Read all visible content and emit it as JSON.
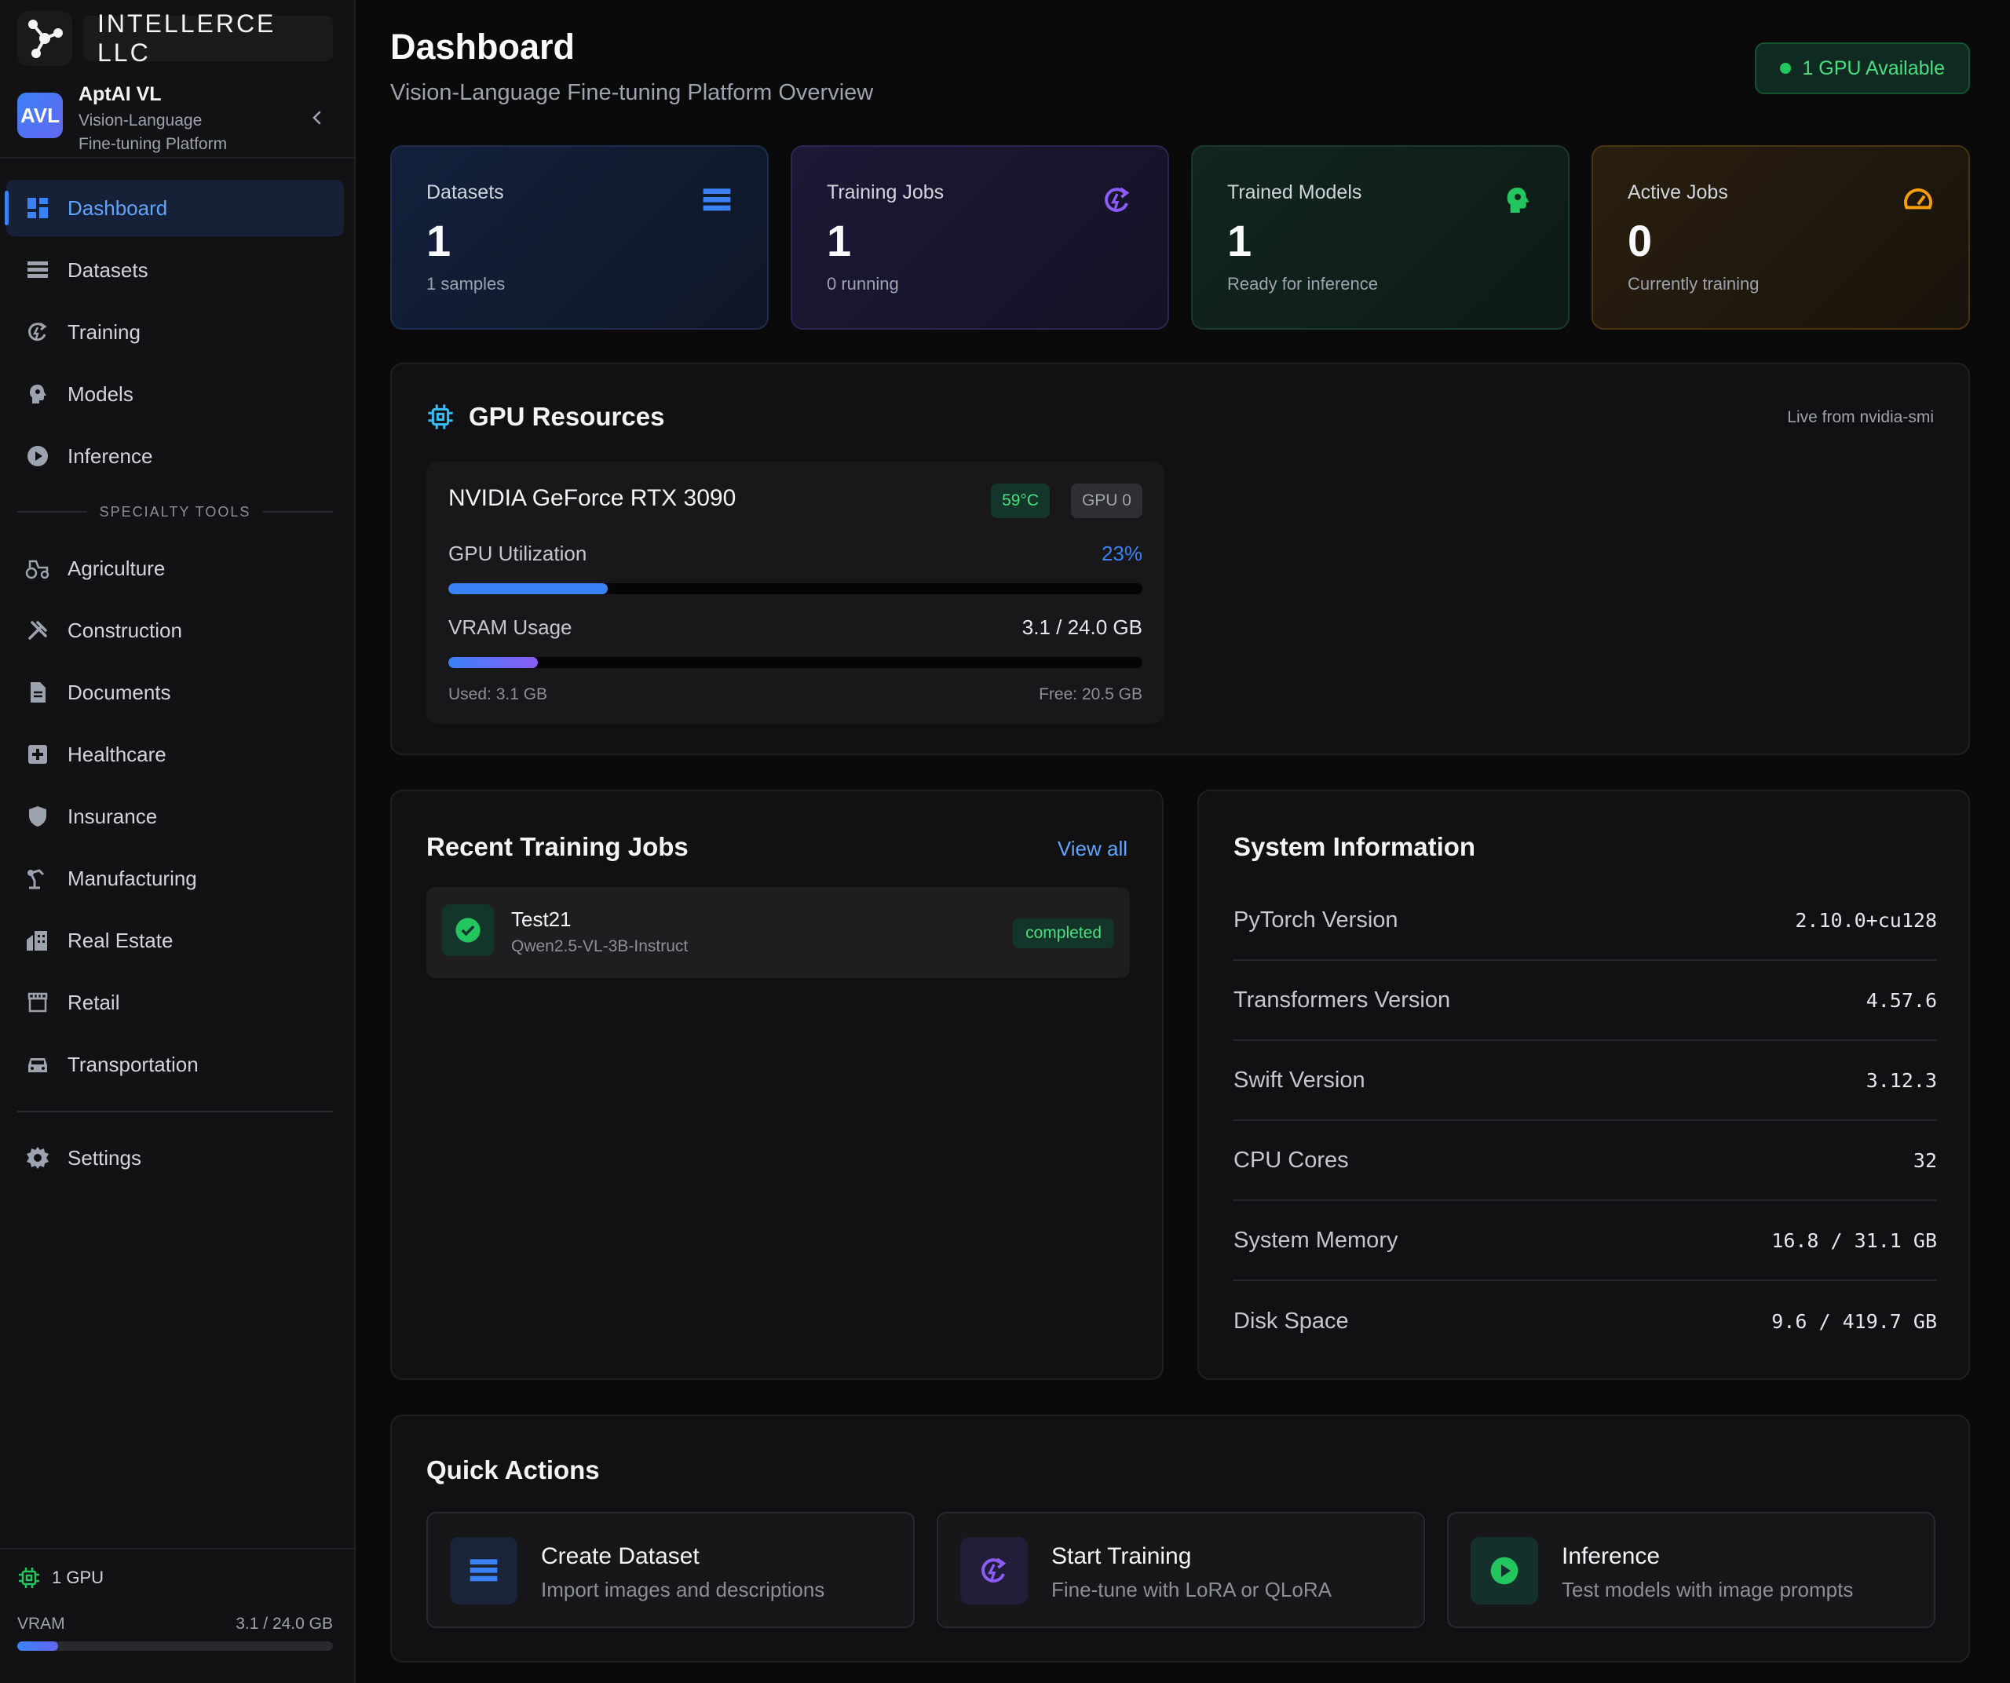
{
  "brand": {
    "wordmark": "INTELLERCE LLC"
  },
  "app": {
    "avatar": "AVL",
    "name": "AptAI VL",
    "subtitle_line1": "Vision-Language",
    "subtitle_line2": "Fine-tuning Platform"
  },
  "nav": {
    "main": [
      {
        "label": "Dashboard",
        "icon": "dashboard-icon",
        "active": true
      },
      {
        "label": "Datasets",
        "icon": "database-icon"
      },
      {
        "label": "Training",
        "icon": "training-icon"
      },
      {
        "label": "Models",
        "icon": "brain-icon"
      },
      {
        "label": "Inference",
        "icon": "play-icon"
      }
    ],
    "section_label": "SPECIALTY TOOLS",
    "specialty": [
      {
        "label": "Agriculture",
        "icon": "tractor-icon"
      },
      {
        "label": "Construction",
        "icon": "tools-icon"
      },
      {
        "label": "Documents",
        "icon": "document-icon"
      },
      {
        "label": "Healthcare",
        "icon": "medical-icon"
      },
      {
        "label": "Insurance",
        "icon": "shield-icon"
      },
      {
        "label": "Manufacturing",
        "icon": "robot-arm-icon"
      },
      {
        "label": "Real Estate",
        "icon": "building-icon"
      },
      {
        "label": "Retail",
        "icon": "store-icon"
      },
      {
        "label": "Transportation",
        "icon": "car-icon"
      }
    ],
    "settings": {
      "label": "Settings",
      "icon": "gear-icon"
    }
  },
  "sidebar_footer": {
    "gpu_count": "1 GPU",
    "vram_label": "VRAM",
    "vram_value": "3.1 / 24.0 GB",
    "vram_fraction": 0.129
  },
  "header": {
    "title": "Dashboard",
    "subtitle": "Vision-Language Fine-tuning Platform Overview",
    "gpu_status": "1 GPU Available"
  },
  "stats": [
    {
      "label": "Datasets",
      "value": "1",
      "sub": "1 samples",
      "icon": "database-icon",
      "color": "#3b82f6"
    },
    {
      "label": "Training Jobs",
      "value": "1",
      "sub": "0 running",
      "icon": "training-icon",
      "color": "#8b5cf6"
    },
    {
      "label": "Trained Models",
      "value": "1",
      "sub": "Ready for inference",
      "icon": "brain-icon",
      "color": "#22c55e"
    },
    {
      "label": "Active Jobs",
      "value": "0",
      "sub": "Currently training",
      "icon": "gauge-icon",
      "color": "#f59e0b"
    }
  ],
  "gpu": {
    "title": "GPU Resources",
    "source": "Live from nvidia-smi",
    "name": "NVIDIA GeForce RTX 3090",
    "temp": "59°C",
    "id": "GPU 0",
    "util_label": "GPU Utilization",
    "util_value": "23%",
    "util_fraction": 0.23,
    "vram_label": "VRAM Usage",
    "vram_value": "3.1 / 24.0 GB",
    "vram_fraction": 0.129,
    "used": "Used: 3.1 GB",
    "free": "Free: 20.5 GB"
  },
  "jobs": {
    "title": "Recent Training Jobs",
    "view_all": "View all",
    "items": [
      {
        "name": "Test21",
        "model": "Qwen2.5-VL-3B-Instruct",
        "status": "completed"
      }
    ]
  },
  "system": {
    "title": "System Information",
    "rows": [
      {
        "key": "PyTorch Version",
        "value": "2.10.0+cu128"
      },
      {
        "key": "Transformers Version",
        "value": "4.57.6"
      },
      {
        "key": "Swift Version",
        "value": "3.12.3"
      },
      {
        "key": "CPU Cores",
        "value": "32"
      },
      {
        "key": "System Memory",
        "value": "16.8 / 31.1 GB"
      },
      {
        "key": "Disk Space",
        "value": "9.6 / 419.7 GB"
      }
    ]
  },
  "quick_actions": {
    "title": "Quick Actions",
    "items": [
      {
        "name": "Create Dataset",
        "desc": "Import images and descriptions",
        "icon": "database-icon"
      },
      {
        "name": "Start Training",
        "desc": "Fine-tune with LoRA or QLoRA",
        "icon": "training-icon"
      },
      {
        "name": "Inference",
        "desc": "Test models with image prompts",
        "icon": "play-icon"
      }
    ]
  }
}
